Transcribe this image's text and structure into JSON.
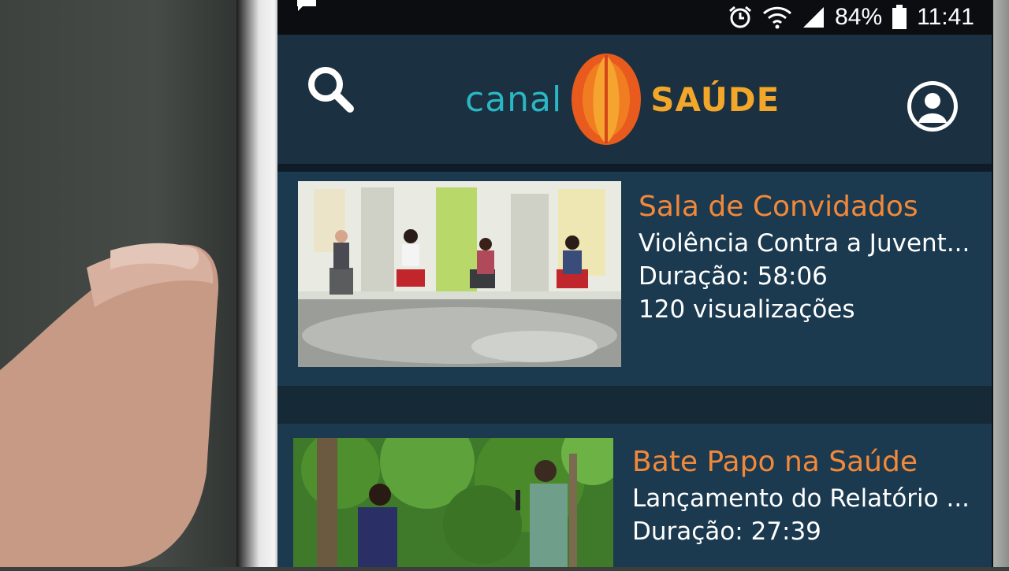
{
  "status_bar": {
    "battery_percent": "84%",
    "time": "11:41",
    "icons": [
      "notification-icon",
      "alarm-icon",
      "wifi-icon",
      "signal-icon",
      "battery-icon"
    ]
  },
  "app_bar": {
    "logo_left": "canal",
    "logo_right": "SAÚDE",
    "colors": {
      "canal": "#2ab7c3",
      "saude": "#f2a62a",
      "bar": "#1b3040"
    }
  },
  "feed": {
    "items": [
      {
        "show": "Sala de Convidados",
        "episode": "Violência Contra a Juvent...",
        "duration": "Duração: 58:06",
        "views": "120 visualizações"
      },
      {
        "show": "Bate Papo na Saúde",
        "episode": "Lançamento do Relatório ...",
        "duration": "Duração: 27:39"
      }
    ]
  },
  "colors": {
    "show_title": "#f2883a",
    "text": "#ffffff",
    "card": "#1b3a4f"
  }
}
